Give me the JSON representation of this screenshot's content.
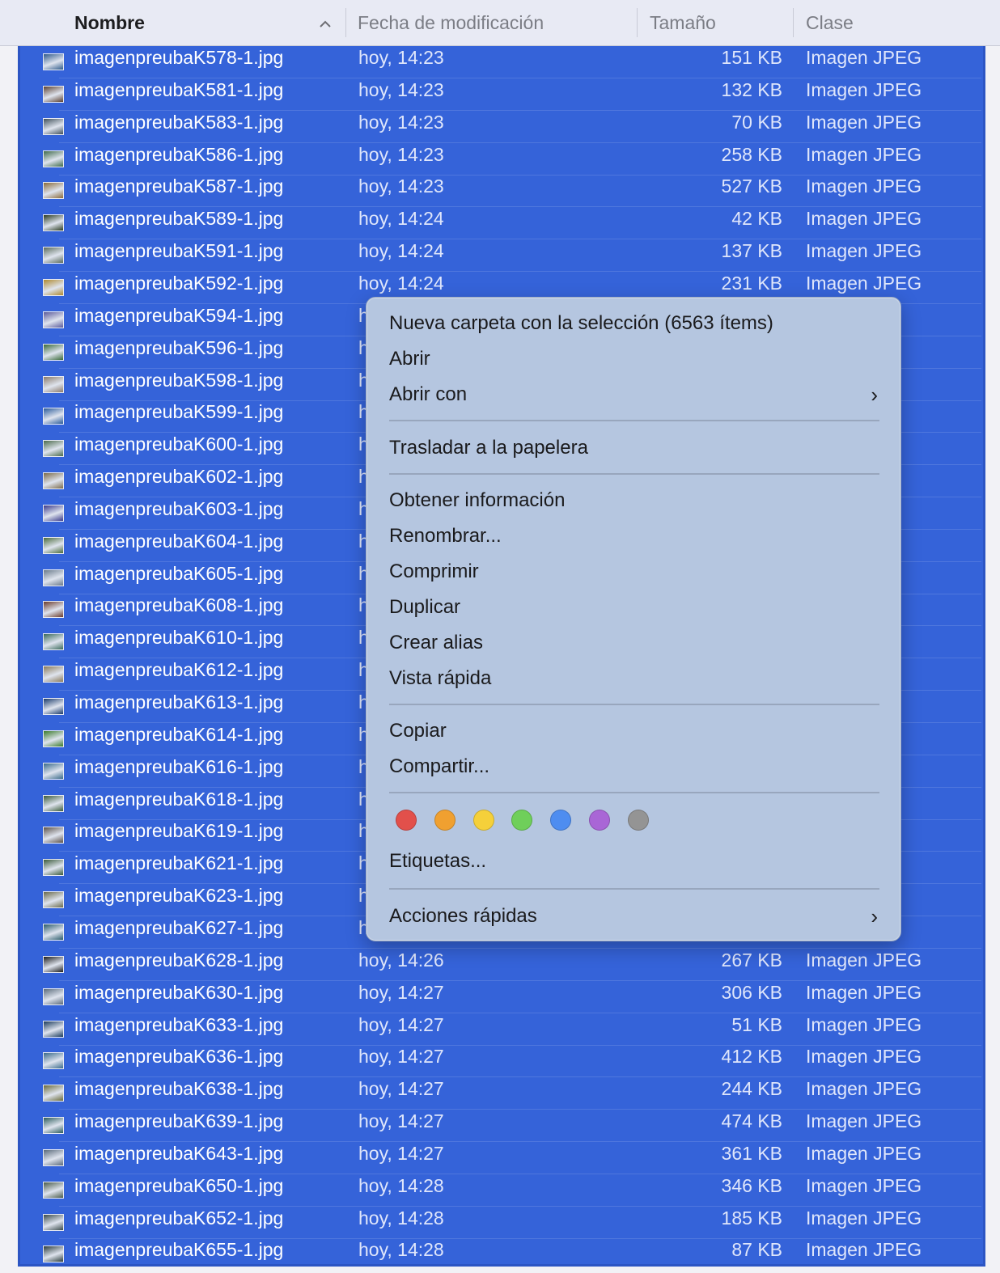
{
  "header": {
    "name": "Nombre",
    "sort_indicator": "^",
    "date": "Fecha de modificación",
    "size": "Tamaño",
    "kind": "Clase"
  },
  "rows": [
    {
      "name": "imagenpreubaK578-1.jpg",
      "date": "hoy, 14:23",
      "size": "151 KB",
      "kind": "Imagen JPEG"
    },
    {
      "name": "imagenpreubaK581-1.jpg",
      "date": "hoy, 14:23",
      "size": "132 KB",
      "kind": "Imagen JPEG"
    },
    {
      "name": "imagenpreubaK583-1.jpg",
      "date": "hoy, 14:23",
      "size": "70 KB",
      "kind": "Imagen JPEG"
    },
    {
      "name": "imagenpreubaK586-1.jpg",
      "date": "hoy, 14:23",
      "size": "258 KB",
      "kind": "Imagen JPEG"
    },
    {
      "name": "imagenpreubaK587-1.jpg",
      "date": "hoy, 14:23",
      "size": "527 KB",
      "kind": "Imagen JPEG"
    },
    {
      "name": "imagenpreubaK589-1.jpg",
      "date": "hoy, 14:24",
      "size": "42 KB",
      "kind": "Imagen JPEG"
    },
    {
      "name": "imagenpreubaK591-1.jpg",
      "date": "hoy, 14:24",
      "size": "137 KB",
      "kind": "Imagen JPEG"
    },
    {
      "name": "imagenpreubaK592-1.jpg",
      "date": "hoy, 14:24",
      "size": "231 KB",
      "kind": "Imagen JPEG"
    },
    {
      "name": "imagenpreubaK594-1.jpg",
      "date": "h",
      "size": "",
      "kind": "EG"
    },
    {
      "name": "imagenpreubaK596-1.jpg",
      "date": "h",
      "size": "",
      "kind": "EG"
    },
    {
      "name": "imagenpreubaK598-1.jpg",
      "date": "h",
      "size": "",
      "kind": "EG"
    },
    {
      "name": "imagenpreubaK599-1.jpg",
      "date": "h",
      "size": "",
      "kind": "EG"
    },
    {
      "name": "imagenpreubaK600-1.jpg",
      "date": "h",
      "size": "",
      "kind": "EG"
    },
    {
      "name": "imagenpreubaK602-1.jpg",
      "date": "h",
      "size": "",
      "kind": "EG"
    },
    {
      "name": "imagenpreubaK603-1.jpg",
      "date": "h",
      "size": "",
      "kind": "EG"
    },
    {
      "name": "imagenpreubaK604-1.jpg",
      "date": "h",
      "size": "",
      "kind": "EG"
    },
    {
      "name": "imagenpreubaK605-1.jpg",
      "date": "h",
      "size": "",
      "kind": "EG"
    },
    {
      "name": "imagenpreubaK608-1.jpg",
      "date": "h",
      "size": "",
      "kind": "EG"
    },
    {
      "name": "imagenpreubaK610-1.jpg",
      "date": "h",
      "size": "",
      "kind": "EG"
    },
    {
      "name": "imagenpreubaK612-1.jpg",
      "date": "h",
      "size": "",
      "kind": "EG"
    },
    {
      "name": "imagenpreubaK613-1.jpg",
      "date": "h",
      "size": "",
      "kind": "EG"
    },
    {
      "name": "imagenpreubaK614-1.jpg",
      "date": "h",
      "size": "",
      "kind": "EG"
    },
    {
      "name": "imagenpreubaK616-1.jpg",
      "date": "h",
      "size": "",
      "kind": "EG"
    },
    {
      "name": "imagenpreubaK618-1.jpg",
      "date": "h",
      "size": "",
      "kind": "EG"
    },
    {
      "name": "imagenpreubaK619-1.jpg",
      "date": "h",
      "size": "",
      "kind": "EG"
    },
    {
      "name": "imagenpreubaK621-1.jpg",
      "date": "h",
      "size": "",
      "kind": "EG"
    },
    {
      "name": "imagenpreubaK623-1.jpg",
      "date": "h",
      "size": "",
      "kind": "EG"
    },
    {
      "name": "imagenpreubaK627-1.jpg",
      "date": "h",
      "size": "",
      "kind": "EG"
    },
    {
      "name": "imagenpreubaK628-1.jpg",
      "date": "hoy, 14:26",
      "size": "267 KB",
      "kind": "Imagen JPEG"
    },
    {
      "name": "imagenpreubaK630-1.jpg",
      "date": "hoy, 14:27",
      "size": "306 KB",
      "kind": "Imagen JPEG"
    },
    {
      "name": "imagenpreubaK633-1.jpg",
      "date": "hoy, 14:27",
      "size": "51 KB",
      "kind": "Imagen JPEG"
    },
    {
      "name": "imagenpreubaK636-1.jpg",
      "date": "hoy, 14:27",
      "size": "412 KB",
      "kind": "Imagen JPEG"
    },
    {
      "name": "imagenpreubaK638-1.jpg",
      "date": "hoy, 14:27",
      "size": "244 KB",
      "kind": "Imagen JPEG"
    },
    {
      "name": "imagenpreubaK639-1.jpg",
      "date": "hoy, 14:27",
      "size": "474 KB",
      "kind": "Imagen JPEG"
    },
    {
      "name": "imagenpreubaK643-1.jpg",
      "date": "hoy, 14:27",
      "size": "361 KB",
      "kind": "Imagen JPEG"
    },
    {
      "name": "imagenpreubaK650-1.jpg",
      "date": "hoy, 14:28",
      "size": "346 KB",
      "kind": "Imagen JPEG"
    },
    {
      "name": "imagenpreubaK652-1.jpg",
      "date": "hoy, 14:28",
      "size": "185 KB",
      "kind": "Imagen JPEG"
    },
    {
      "name": "imagenpreubaK655-1.jpg",
      "date": "hoy, 14:28",
      "size": "87 KB",
      "kind": "Imagen JPEG"
    }
  ],
  "thumb_colors": [
    "#2f5a8a",
    "#5a4030",
    "#40505a",
    "#3f6a4a",
    "#8a6a3a",
    "#2a3a20",
    "#5a6a5a",
    "#b08a30",
    "#5a5a9a",
    "#3a6a3a",
    "#8a7a6a",
    "#2a5a9a",
    "#4a6a4a",
    "#7a6a4a",
    "#3a3a8a",
    "#4a6a3a",
    "#6a7a8a",
    "#6a3a2a",
    "#3a6a5a",
    "#8a7a5a",
    "#1a3a6a",
    "#3a7a2a",
    "#3a6a8a",
    "#3a5a3a",
    "#5a5048",
    "#3a5a3a",
    "#6a6a4a",
    "#2a5a6a",
    "#1a1a1a",
    "#5a6a7a",
    "#1a3a5a",
    "#3a6a8a",
    "#6a6a3a",
    "#2a5a5a",
    "#5a6a7a",
    "#4a5a4a",
    "#3a4a4a",
    "#2a3a3a"
  ],
  "menu": {
    "new_folder": "Nueva carpeta con la selección (6563 ítems)",
    "open": "Abrir",
    "open_with": "Abrir con",
    "chevron": "›",
    "trash": "Trasladar a la papelera",
    "get_info": "Obtener información",
    "rename": "Renombrar...",
    "compress": "Comprimir",
    "duplicate": "Duplicar",
    "make_alias": "Crear alias",
    "quick_look": "Vista rápida",
    "copy": "Copiar",
    "share": "Compartir...",
    "tags": "Etiquetas...",
    "quick_actions": "Acciones rápidas",
    "tag_colors": [
      {
        "name": "red",
        "color": "#e2504b"
      },
      {
        "name": "orange",
        "color": "#f0a030"
      },
      {
        "name": "yellow",
        "color": "#f5d03a"
      },
      {
        "name": "green",
        "color": "#6fcf5a"
      },
      {
        "name": "blue",
        "color": "#4e8df0"
      },
      {
        "name": "purple",
        "color": "#a966d6"
      },
      {
        "name": "gray",
        "color": "#949494"
      }
    ]
  }
}
